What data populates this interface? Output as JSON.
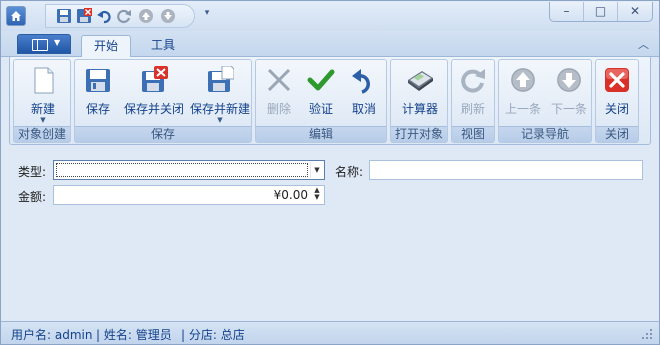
{
  "quick_access": {
    "items": [
      "save-icon",
      "save-close-icon",
      "undo-icon",
      "redo-icon",
      "up-icon",
      "down-icon"
    ]
  },
  "window_controls": {
    "minimize": "–",
    "maximize": "□",
    "close": "✕"
  },
  "tabs": [
    {
      "label": "开始",
      "active": true
    },
    {
      "label": "工具",
      "active": false
    }
  ],
  "ribbon": {
    "groups": {
      "create": {
        "label": "对象创建",
        "new": "新建"
      },
      "save": {
        "label": "保存",
        "save": "保存",
        "save_close": "保存并关闭",
        "save_new": "保存并新建"
      },
      "edit": {
        "label": "编辑",
        "delete": "删除",
        "validate": "验证",
        "cancel": "取消"
      },
      "open": {
        "label": "打开对象",
        "calculator": "计算器"
      },
      "view": {
        "label": "视图",
        "refresh": "刷新"
      },
      "nav": {
        "label": "记录导航",
        "prev": "上一条",
        "next": "下一条"
      },
      "close": {
        "label": "关闭",
        "close": "关闭"
      }
    }
  },
  "form": {
    "type_label": "类型:",
    "type_value": "",
    "name_label": "名称:",
    "name_value": "",
    "amount_label": "金额:",
    "amount_value": "¥0.00"
  },
  "status": {
    "user": "用户名: admin",
    "name": "| 姓名: 管理员",
    "branch": "| 分店: 总店"
  },
  "colors": {
    "accent": "#15428b",
    "close_red": "#d9302a",
    "check_green": "#2e9a2e"
  }
}
